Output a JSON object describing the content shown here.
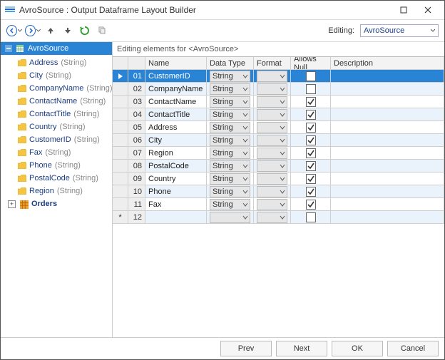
{
  "window": {
    "title": "AvroSource : Output Dataframe Layout Builder"
  },
  "toolbar": {
    "editing_label": "Editing:",
    "editing_value": "AvroSource"
  },
  "sidebar": {
    "root": "AvroSource",
    "fields": [
      {
        "name": "Address",
        "type": "(String)"
      },
      {
        "name": "City",
        "type": "(String)"
      },
      {
        "name": "CompanyName",
        "type": "(String)"
      },
      {
        "name": "ContactName",
        "type": "(String)"
      },
      {
        "name": "ContactTitle",
        "type": "(String)"
      },
      {
        "name": "Country",
        "type": "(String)"
      },
      {
        "name": "CustomerID",
        "type": "(String)"
      },
      {
        "name": "Fax",
        "type": "(String)"
      },
      {
        "name": "Phone",
        "type": "(String)"
      },
      {
        "name": "PostalCode",
        "type": "(String)"
      },
      {
        "name": "Region",
        "type": "(String)"
      }
    ],
    "child_node": "Orders"
  },
  "main": {
    "heading": "Editing elements for <AvroSource>",
    "columns": {
      "name": "Name",
      "data_type": "Data Type",
      "format": "Format",
      "allows_null": "Allows Null",
      "description": "Description"
    },
    "rows": [
      {
        "num": "01",
        "name": "CustomerID",
        "dtype": "String",
        "null": false,
        "sel": true
      },
      {
        "num": "02",
        "name": "CompanyName",
        "dtype": "String",
        "null": false,
        "sel": false
      },
      {
        "num": "03",
        "name": "ContactName",
        "dtype": "String",
        "null": true,
        "sel": false
      },
      {
        "num": "04",
        "name": "ContactTitle",
        "dtype": "String",
        "null": true,
        "sel": false
      },
      {
        "num": "05",
        "name": "Address",
        "dtype": "String",
        "null": true,
        "sel": false
      },
      {
        "num": "06",
        "name": "City",
        "dtype": "String",
        "null": true,
        "sel": false
      },
      {
        "num": "07",
        "name": "Region",
        "dtype": "String",
        "null": true,
        "sel": false
      },
      {
        "num": "08",
        "name": "PostalCode",
        "dtype": "String",
        "null": true,
        "sel": false
      },
      {
        "num": "09",
        "name": "Country",
        "dtype": "String",
        "null": true,
        "sel": false
      },
      {
        "num": "10",
        "name": "Phone",
        "dtype": "String",
        "null": true,
        "sel": false
      },
      {
        "num": "11",
        "name": "Fax",
        "dtype": "String",
        "null": true,
        "sel": false
      }
    ],
    "new_row_num": "12",
    "new_row_glyph": "*"
  },
  "footer": {
    "prev": "Prev",
    "next": "Next",
    "ok": "OK",
    "cancel": "Cancel"
  }
}
